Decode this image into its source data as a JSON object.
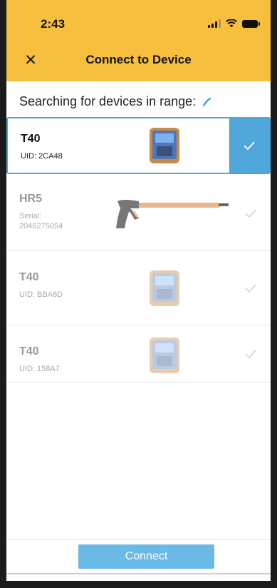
{
  "status_bar": {
    "time": "2:43"
  },
  "nav": {
    "title": "Connect to Device",
    "close_label": "✕"
  },
  "searching_text": "Searching for devices in range:",
  "devices": [
    {
      "name": "T40",
      "id_label": "UID: 2CA48",
      "type": "t40",
      "selected": true
    },
    {
      "name": "HR5",
      "id_label": "Serial:\n2046275054",
      "type": "hr5",
      "selected": false
    },
    {
      "name": "T40",
      "id_label": "UID: BBA6D",
      "type": "t40",
      "selected": false
    },
    {
      "name": "T40",
      "id_label": "UID: 158A7",
      "type": "t40",
      "selected": false
    }
  ],
  "footer": {
    "connect_label": "Connect"
  },
  "colors": {
    "header": "#f7bf3e",
    "accent": "#4fa6d8",
    "button": "#6ab9e6"
  }
}
